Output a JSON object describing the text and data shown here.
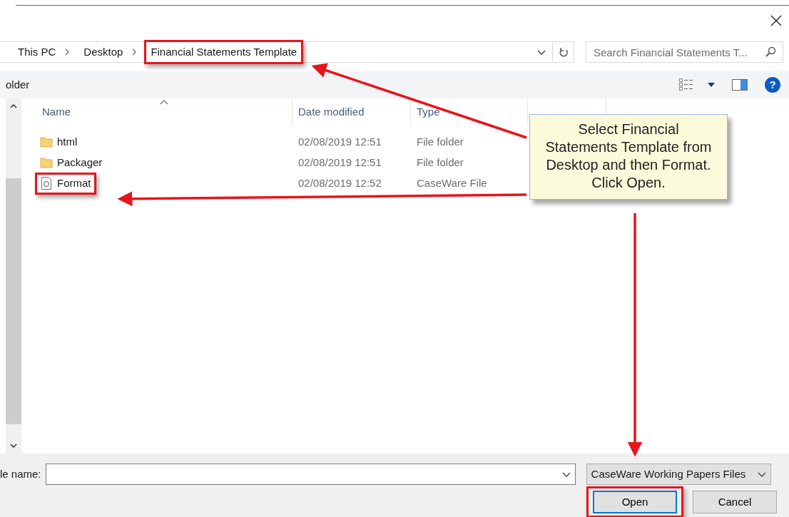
{
  "breadcrumb": [
    {
      "label": "This PC",
      "highlighted": false
    },
    {
      "label": "Desktop",
      "highlighted": false
    },
    {
      "label": "Financial Statements Template",
      "highlighted": true
    }
  ],
  "search": {
    "placeholder": "Search Financial Statements T..."
  },
  "toolbar": {
    "new_folder_label": "older",
    "help_glyph": "?"
  },
  "columns": [
    "Name",
    "Date modified",
    "Type"
  ],
  "rows": [
    {
      "name": "html",
      "kind": "folder",
      "date": "02/08/2019 12:51",
      "type": "File folder",
      "highlighted": false
    },
    {
      "name": "Packager",
      "kind": "folder",
      "date": "02/08/2019 12:51",
      "type": "File folder",
      "highlighted": false
    },
    {
      "name": "Format",
      "kind": "file",
      "date": "02/08/2019 12:52",
      "type": "CaseWare File",
      "highlighted": true
    }
  ],
  "footer": {
    "file_name_label": "le name:",
    "file_type": "CaseWare Working Papers Files"
  },
  "buttons": [
    {
      "label": "Open",
      "kind": "default",
      "highlighted": true
    },
    {
      "label": "Cancel",
      "kind": "normal",
      "highlighted": false
    }
  ],
  "callout": {
    "text": "Select Financial Statements Template from Desktop and then Format. Click Open."
  }
}
